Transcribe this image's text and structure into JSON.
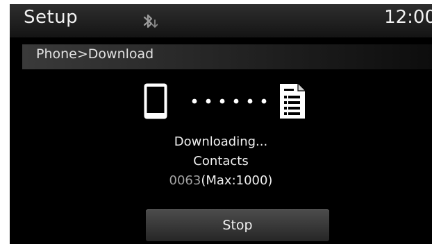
{
  "header": {
    "title": "Setup",
    "clock": "12:00",
    "bluetooth_icon": "bluetooth-download-icon"
  },
  "breadcrumb": {
    "text": "Phone>Download"
  },
  "transfer": {
    "source_icon": "phone-icon",
    "dest_icon": "contacts-document-icon",
    "progress_dots": 6
  },
  "status": {
    "line1": "Downloading...",
    "line2": "Contacts",
    "count": "0063",
    "max": "(Max:1000)"
  },
  "actions": {
    "stop_label": "Stop"
  },
  "colors": {
    "background": "#000000",
    "text": "#f0f0f0",
    "count_text": "#a4a4a4",
    "button": "#3a3a3a"
  }
}
